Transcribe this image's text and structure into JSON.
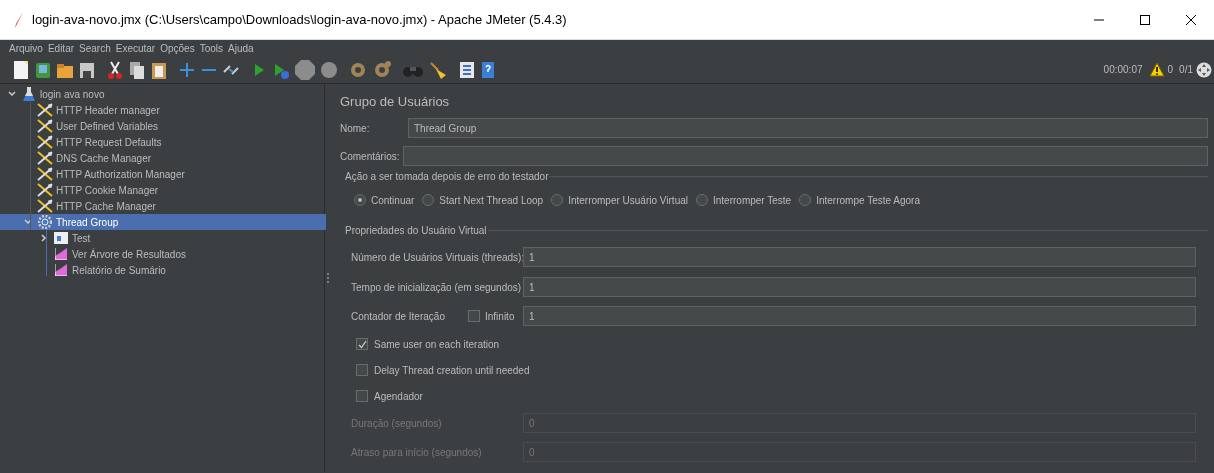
{
  "window": {
    "title": "login-ava-novo.jmx (C:\\Users\\campo\\Downloads\\login-ava-novo.jmx) - Apache JMeter (5.4.3)"
  },
  "menu": [
    "Arquivo",
    "Editar",
    "Search",
    "Executar",
    "Opções",
    "Tools",
    "Ajuda"
  ],
  "status": {
    "elapsed": "00:00:07",
    "warnings": "0",
    "threads": "0/1"
  },
  "tree": [
    {
      "label": "login ava novo",
      "kind": "plan",
      "selected": false,
      "expanded": true,
      "children": [
        {
          "label": "HTTP Header manager",
          "kind": "config",
          "selected": false
        },
        {
          "label": "User Defined Variables",
          "kind": "config",
          "selected": false
        },
        {
          "label": "HTTP Request Defaults",
          "kind": "config",
          "selected": false
        },
        {
          "label": "DNS Cache Manager",
          "kind": "config",
          "selected": false
        },
        {
          "label": "HTTP Authorization Manager",
          "kind": "config",
          "selected": false
        },
        {
          "label": "HTTP Cookie Manager",
          "kind": "config",
          "selected": false
        },
        {
          "label": "HTTP Cache Manager",
          "kind": "config",
          "selected": false
        },
        {
          "label": "Thread Group",
          "kind": "threads",
          "selected": true,
          "expanded": true,
          "children": [
            {
              "label": "Test",
              "kind": "controller",
              "selected": false,
              "expanded": false
            },
            {
              "label": "Ver Árvore de Resultados",
              "kind": "listener",
              "selected": false
            },
            {
              "label": "Relatório de Sumário",
              "kind": "listener",
              "selected": false
            }
          ]
        }
      ]
    }
  ],
  "panel": {
    "title": "Grupo de Usuários",
    "name": {
      "label": "Nome:",
      "value": "Thread Group"
    },
    "comments": {
      "label": "Comentários:"
    },
    "error_action": {
      "legend": "Ação a ser tomada depois de erro do testador",
      "options": [
        {
          "label": "Continuar",
          "selected": true
        },
        {
          "label": "Start Next Thread Loop",
          "selected": false
        },
        {
          "label": "Interromper Usuário Virtual",
          "selected": false
        },
        {
          "label": "Interromper Teste",
          "selected": false
        },
        {
          "label": "Interrompe Teste Agora",
          "selected": false
        }
      ]
    },
    "properties": {
      "legend": "Propriedades do Usuário Virtual",
      "threads": {
        "label": "Número de Usuários Virtuais (threads):",
        "value": "1"
      },
      "ramp_up": {
        "label": "Tempo de inicialização (em segundos)",
        "value": "1"
      },
      "loop": {
        "label": "Contador de Iteração",
        "infinite_label": "Infinito",
        "infinite_checked": false,
        "value": "1"
      },
      "checks": [
        {
          "label": "Same user on each iteration",
          "checked": true
        },
        {
          "label": "Delay Thread creation until needed",
          "checked": false
        },
        {
          "label": "Agendador",
          "checked": false
        }
      ],
      "schedule": [
        {
          "label": "Duração (segundos)",
          "value": "0",
          "disabled": true
        },
        {
          "label": "Atraso para início (segundos)",
          "value": "0",
          "disabled": true
        }
      ]
    }
  }
}
